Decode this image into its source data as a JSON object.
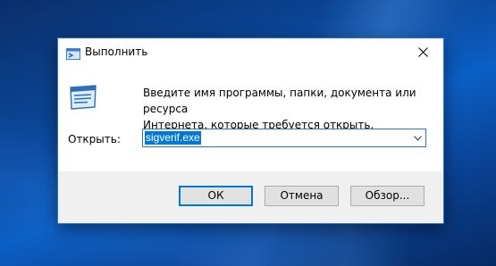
{
  "window": {
    "title": "Выполнить",
    "title_icon": "run-icon",
    "close_icon": "close-icon"
  },
  "content": {
    "description_line1": "Введите имя программы, папки, документа или ресурса",
    "description_line2": "Интернета, которые требуется открыть.",
    "big_icon": "run-icon"
  },
  "open_field": {
    "label": "Открыть:",
    "value": "sigverif.exe",
    "dropdown_icon": "chevron-down-icon"
  },
  "buttons": {
    "ok": "ОК",
    "cancel": "Отмена",
    "browse": "Обзор..."
  },
  "colors": {
    "accent": "#0078d7",
    "window_border": "#2b74c8",
    "button_face": "#e1e1e1",
    "footer_bg": "#f0f0f0"
  }
}
